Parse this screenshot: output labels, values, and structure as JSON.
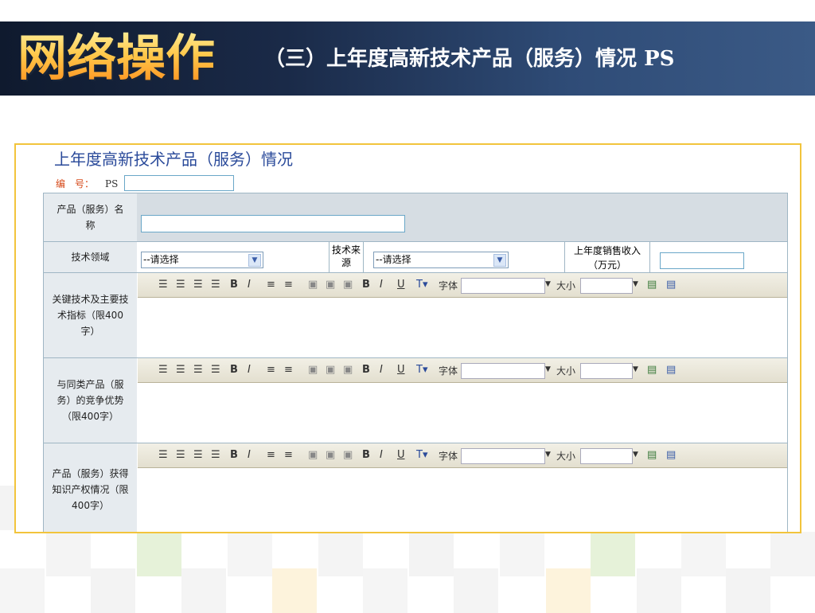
{
  "banner": {
    "logo_text": "网络操作",
    "title": "（三）上年度高新技术产品（服务）情况",
    "title_suffix": "PS"
  },
  "form": {
    "title": "上年度高新技术产品（服务）情况",
    "code_label": "编　号：",
    "code_prefix": "PS",
    "rows": {
      "name_label": "产品（服务）名称",
      "tech_field_label": "技术领域",
      "tech_field_select": "--请选择",
      "tech_source_label": "技术来源",
      "tech_source_select": "--请选择",
      "sales_label": "上年度销售收入（万元）",
      "key_tech_label": "关键技术及主要技术指标（限400 字）",
      "advantage_label": "与同类产品（服务）的竞争优势（限400字）",
      "ip_label": "产品（服务）获得知识产权情况（限400字）"
    },
    "toolbar": {
      "font_label": "字体",
      "size_label": "大小",
      "bold": "B",
      "italic": "I",
      "underline": "U",
      "bold2": "B",
      "italic2": "I"
    }
  },
  "colors": {
    "banner_dark": "#0f1a2e",
    "banner_light": "#3b5a86",
    "logo_orange": "#ff8a1a",
    "frame_border": "#f2c43c",
    "form_title": "#2a4a9a",
    "label_bg": "#d6dde3"
  }
}
